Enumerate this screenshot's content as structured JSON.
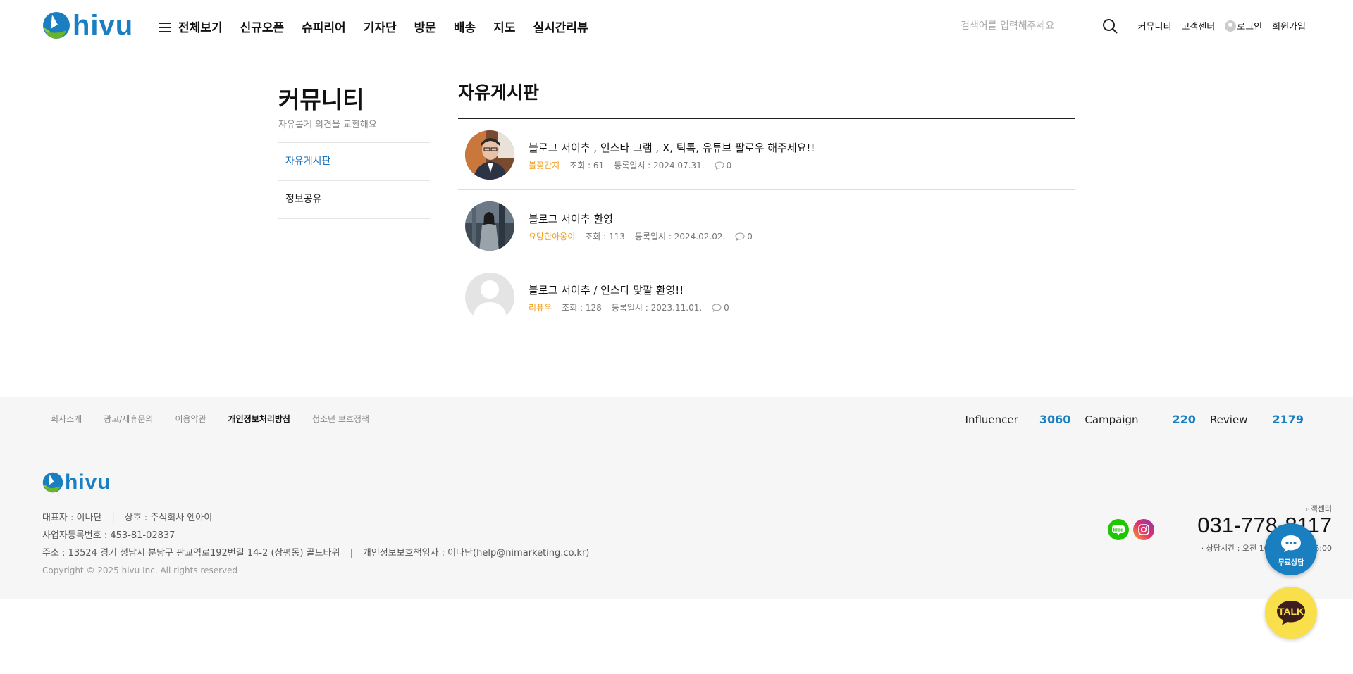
{
  "header": {
    "logo_text": "hivu",
    "nav": [
      "전체보기",
      "신규오픈",
      "슈피리어",
      "기자단",
      "방문",
      "배송",
      "지도",
      "실시간리뷰"
    ],
    "search_placeholder": "검색어를 입력해주세요",
    "util": {
      "community": "커뮤니티",
      "support": "고객센터",
      "login": "로그인",
      "signup": "회원가입"
    }
  },
  "sidebar": {
    "title": "커뮤니티",
    "subtitle": "자유롭게 의견을 교환해요",
    "items": [
      {
        "label": "자유게시판",
        "active": true
      },
      {
        "label": "정보공유",
        "active": false
      }
    ]
  },
  "board": {
    "title": "자유게시판",
    "posts": [
      {
        "title": "블로그 서이추 , 인스타 그램 , X, 틱톡, 유튜브 팔로우 해주세요!!",
        "author": "블꽃간지",
        "views": "조회 : 61",
        "date": "등록일시 : 2024.07.31.",
        "comments": "0"
      },
      {
        "title": "블로그 서이추 환영",
        "author": "요망한아옹이",
        "views": "조회 : 113",
        "date": "등록일시 : 2024.02.02.",
        "comments": "0"
      },
      {
        "title": "블로그 서이추 / 인스타 맞팔 환영!!",
        "author": "리퓨우",
        "views": "조회 : 128",
        "date": "등록일시 : 2023.11.01.",
        "comments": "0"
      }
    ]
  },
  "footer": {
    "links": [
      {
        "label": "회사소개",
        "bold": false
      },
      {
        "label": "광고/제휴문의",
        "bold": false
      },
      {
        "label": "이용약관",
        "bold": false
      },
      {
        "label": "개인정보처리방침",
        "bold": true
      },
      {
        "label": "청소년 보호정책",
        "bold": false
      }
    ],
    "stats": {
      "influencer_label": "Influencer",
      "influencer_value": "3060",
      "campaign_label": "Campaign",
      "campaign_value": "220",
      "review_label": "Review",
      "review_value": "2179"
    },
    "logo_text": "hivu",
    "ceo": "대표자 : 이나단",
    "company": "상호 : 주식회사 엔아이",
    "business_no": "사업자등록번호 : 453-81-02837",
    "address": "주소 : 13524 경기 성남시 분당구 판교역로192번길 14-2 (삼평동) 골드타워",
    "privacy_officer": "개인정보보호책임자 : 이나단(help@nimarketing.co.kr)",
    "copyright": "Copyright © 2025 hivu Inc. All rights reserved",
    "cs_label": "고객센터",
    "cs_phone": "031-778-8117",
    "cs_hours": "· 상담시간 : 오전 10:00 ~ 오후 06:00"
  },
  "floating": {
    "consult_label": "무료상담",
    "talk_label": "TALK"
  },
  "colors": {
    "brand": "#1a7fc1",
    "author": "#f0a020",
    "active_menu": "#1a6fb8",
    "talk_bg": "#f9df4a"
  }
}
